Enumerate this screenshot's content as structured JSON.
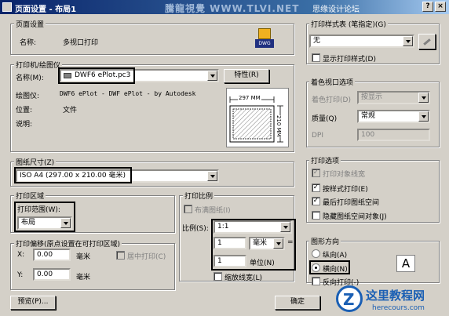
{
  "title": "页面设置 - 布局1",
  "watermark": "騰龍視覺 WWW.TLVI.NET",
  "site_banner": "思缘设计论坛",
  "title_buttons": {
    "help": "?",
    "close": "×"
  },
  "page_setup": {
    "label": "页面设置",
    "name_label": "名称:",
    "name_value": "多视口打印",
    "dwg": "DWG"
  },
  "printer": {
    "label": "打印机/绘图仪",
    "name_label": "名称(M):",
    "name_value": "DWF6 ePlot.pc3",
    "properties_button": "特性(R)",
    "plotter_label": "绘图仪:",
    "plotter_value": "DWF6 ePlot - DWF ePlot - by Autodesk",
    "where_label": "位置:",
    "where_value": "文件",
    "desc_label": "说明:",
    "preview_width": "297 MM",
    "preview_height": "210 MM"
  },
  "paper_size": {
    "label": "图纸尺寸(Z)",
    "value": "ISO A4 (297.00 x 210.00 毫米)"
  },
  "plot_area": {
    "label": "打印区域",
    "range_label": "打印范围(W):",
    "range_value": "布局"
  },
  "plot_offset": {
    "label": "打印偏移(原点设置在可打印区域)",
    "x_label": "X:",
    "x_value": "0.00",
    "x_unit": "毫米",
    "center_label": "居中打印(C)",
    "y_label": "Y:",
    "y_value": "0.00",
    "y_unit": "毫米"
  },
  "plot_scale": {
    "label": "打印比例",
    "fit_label": "布满图纸(I)",
    "scale_label": "比例(S):",
    "scale_value": "1:1",
    "value1": "1",
    "unit_value": "毫米",
    "equals": "=",
    "value2": "1",
    "unit_label": "单位(N)",
    "lineweights_label": "缩放线宽(L)"
  },
  "style_table": {
    "label": "打印样式表 (笔指定)(G)",
    "value": "无",
    "display_label": "显示打印样式(D)"
  },
  "shaded": {
    "label": "着色视口选项",
    "shade_label": "着色打印(D)",
    "shade_value": "按显示",
    "quality_label": "质量(Q)",
    "quality_value": "常规",
    "dpi_label": "DPI",
    "dpi_value": "100"
  },
  "plot_options": {
    "label": "打印选项",
    "items": [
      "打印对象线宽",
      "按样式打印(E)",
      "最后打印图纸空间",
      "隐藏图纸空间对象(J)"
    ]
  },
  "orientation": {
    "label": "图形方向",
    "portrait": "纵向(A)",
    "landscape": "横向(N)",
    "upside_down": "反向打印(-)",
    "glyph": "A"
  },
  "buttons": {
    "preview": "预览(P)...",
    "ok": "确定"
  },
  "site_logo": {
    "text": "这里教程网",
    "url": "herecours.com"
  }
}
